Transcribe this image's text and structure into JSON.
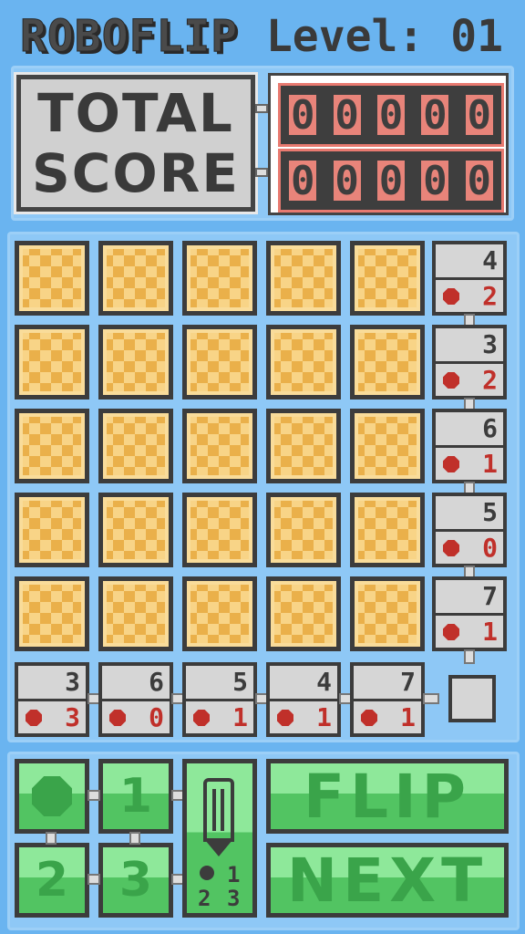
{
  "header": {
    "title": "ROBOFLIP",
    "level": "Level: 01"
  },
  "score": {
    "label_line1": "TOTAL",
    "label_line2": "SCORE",
    "row1_digits": [
      "0",
      "0",
      "0",
      "0",
      "0"
    ],
    "row2_digits": [
      "0",
      "0",
      "0",
      "0",
      "0"
    ]
  },
  "board": {
    "rows": 5,
    "cols": 5,
    "tile_state": "face-down",
    "row_hints": [
      {
        "sum": "4",
        "bombs": "2"
      },
      {
        "sum": "3",
        "bombs": "2"
      },
      {
        "sum": "6",
        "bombs": "1"
      },
      {
        "sum": "5",
        "bombs": "0"
      },
      {
        "sum": "7",
        "bombs": "1"
      }
    ],
    "col_hints": [
      {
        "sum": "3",
        "bombs": "3"
      },
      {
        "sum": "6",
        "bombs": "0"
      },
      {
        "sum": "5",
        "bombs": "1"
      },
      {
        "sum": "4",
        "bombs": "1"
      },
      {
        "sum": "7",
        "bombs": "1"
      }
    ]
  },
  "controls": {
    "memo_bomb_icon": "octagon-bomb-icon",
    "memo_1": "1",
    "memo_2": "2",
    "memo_3": "3",
    "memo_mode": {
      "label_1": "1",
      "label_2": "2",
      "label_3": "3"
    },
    "flip_label": "FLIP",
    "next_label": "NEXT"
  },
  "colors": {
    "background": "#6ab4f0",
    "tile_light": "#f8d487",
    "tile_dark": "#eab04a",
    "hint_bg": "#d6d6d6",
    "bomb_red": "#c0302a",
    "button_green": "#52c462",
    "score_red": "#e8847a"
  }
}
